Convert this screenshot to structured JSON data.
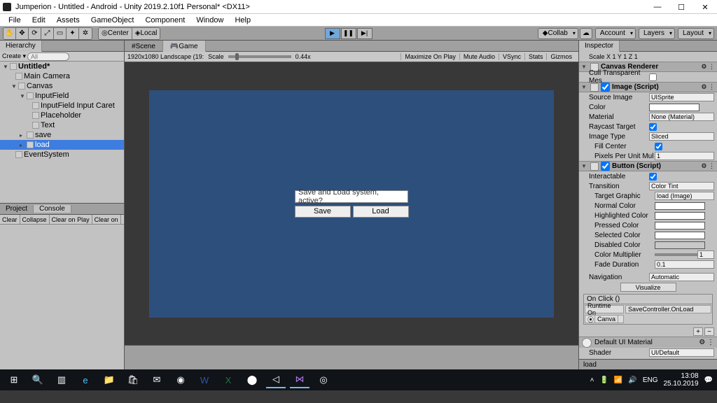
{
  "title": "Jumperion - Untitled - Android - Unity 2019.2.10f1 Personal* <DX11>",
  "menu": [
    "File",
    "Edit",
    "Assets",
    "GameObject",
    "Component",
    "Window",
    "Help"
  ],
  "toolbar": {
    "center": "Center",
    "local": "Local",
    "collab": "Collab",
    "account": "Account",
    "layers": "Layers",
    "layout": "Layout"
  },
  "hierarchy": {
    "tab": "Hierarchy",
    "create": "Create",
    "search_ph": "All",
    "scene": "Untitled*",
    "items": [
      "Main Camera",
      "Canvas",
      "InputField",
      "InputField Input Caret",
      "Placeholder",
      "Text",
      "save",
      "load",
      "EventSystem"
    ]
  },
  "project": {
    "tab1": "Project",
    "tab2": "Console",
    "btns": [
      "Clear",
      "Collapse",
      "Clear on Play",
      "Clear on"
    ]
  },
  "view": {
    "tab_scene": "Scene",
    "tab_game": "Game",
    "resolution": "1920x1080 Landscape (19:",
    "scale_label": "Scale",
    "scale_val": "0.44x",
    "right_opts": [
      "Maximize On Play",
      "Mute Audio",
      "VSync",
      "Stats",
      "Gizmos"
    ]
  },
  "game": {
    "input_text": "Save and Load system, active?",
    "save": "Save",
    "load": "Load"
  },
  "inspector": {
    "tab": "Inspector",
    "scale_row": "Scale   X 1   Y 1   Z 1",
    "comp1": "Canvas Renderer",
    "cull": "Cull Transparent Mes",
    "comp2": "Image (Script)",
    "img": {
      "source": "Source Image",
      "source_v": "UISprite",
      "color": "Color",
      "material": "Material",
      "material_v": "None (Material)",
      "raycast": "Raycast Target",
      "imgtype": "Image Type",
      "imgtype_v": "Sliced",
      "fill": "Fill Center",
      "ppu": "Pixels Per Unit Mul",
      "ppu_v": "1"
    },
    "comp3": "Button (Script)",
    "btn": {
      "interactable": "Interactable",
      "transition": "Transition",
      "transition_v": "Color Tint",
      "target": "Target Graphic",
      "target_v": "load (Image)",
      "normal": "Normal Color",
      "high": "Highlighted Color",
      "press": "Pressed Color",
      "sel": "Selected Color",
      "dis": "Disabled Color",
      "mult": "Color Multiplier",
      "mult_v": "1",
      "fade": "Fade Duration",
      "fade_v": "0.1",
      "nav": "Navigation",
      "nav_v": "Automatic",
      "visualize": "Visualize"
    },
    "onclick": {
      "head": "On Click ()",
      "runtime": "Runtime On",
      "func": "SaveController.OnLoad",
      "obj": "Canva"
    },
    "material": "Default UI Material",
    "shader_lbl": "Shader",
    "shader_v": "UI/Default",
    "footer": "load"
  },
  "tray": {
    "lang": "ENG",
    "time": "13:08",
    "date": "25.10.2019"
  }
}
